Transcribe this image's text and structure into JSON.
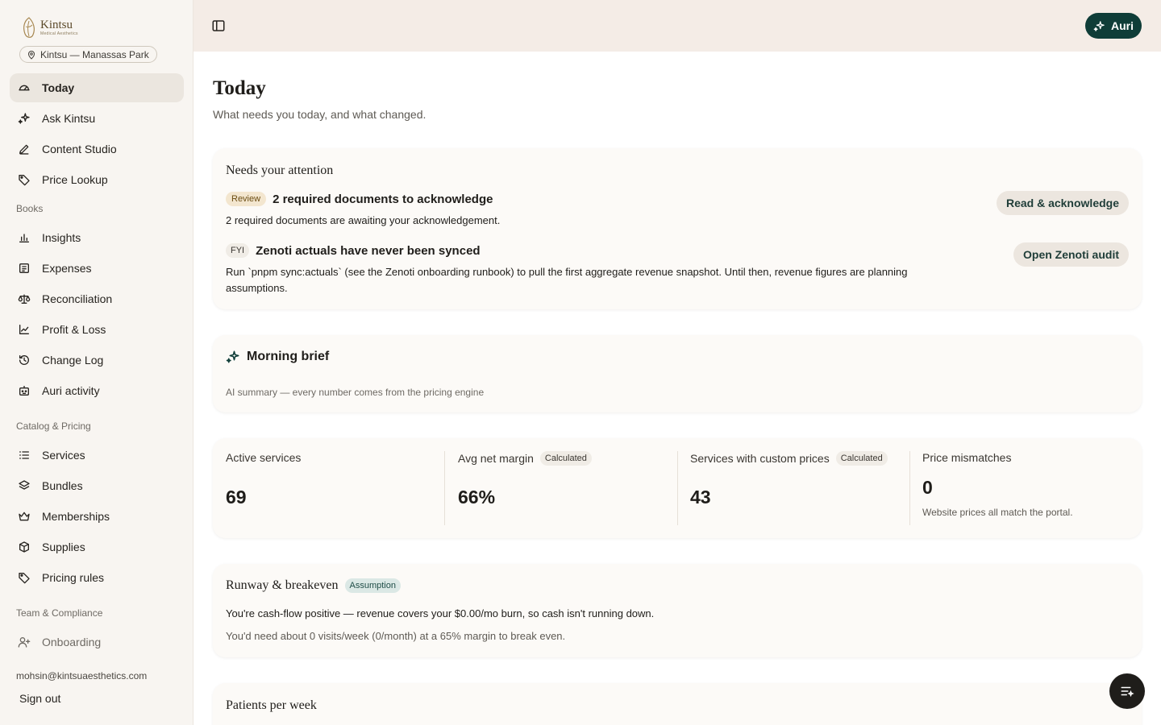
{
  "brand": {
    "name": "Kintsu",
    "subtitle": "Medical Aesthetics",
    "location": "Kintsu — Manassas Park"
  },
  "sidebar": {
    "primary": [
      {
        "label": "Today",
        "icon": "gauge-icon",
        "active": true
      },
      {
        "label": "Ask Kintsu",
        "icon": "sparkle-icon"
      },
      {
        "label": "Content Studio",
        "icon": "pen-icon"
      },
      {
        "label": "Price Lookup",
        "icon": "tag-icon"
      }
    ],
    "books_label": "Books",
    "books": [
      {
        "label": "Insights",
        "icon": "bar-chart-icon"
      },
      {
        "label": "Expenses",
        "icon": "receipt-icon"
      },
      {
        "label": "Reconciliation",
        "icon": "scale-icon"
      },
      {
        "label": "Profit & Loss",
        "icon": "line-chart-icon"
      },
      {
        "label": "Change Log",
        "icon": "history-icon"
      },
      {
        "label": "Auri activity",
        "icon": "bot-icon"
      }
    ],
    "catalog_label": "Catalog & Pricing",
    "catalog": [
      {
        "label": "Services",
        "icon": "list-icon"
      },
      {
        "label": "Bundles",
        "icon": "layers-icon"
      },
      {
        "label": "Memberships",
        "icon": "crown-icon"
      },
      {
        "label": "Supplies",
        "icon": "box-icon"
      },
      {
        "label": "Pricing rules",
        "icon": "tag-icon"
      }
    ],
    "team_label": "Team & Compliance",
    "team": [
      {
        "label": "Onboarding",
        "icon": "user-plus-icon"
      }
    ],
    "email": "mohsin@kintsuaesthetics.com",
    "signout": "Sign out"
  },
  "header": {
    "auri_label": "Auri"
  },
  "page": {
    "title": "Today",
    "subtitle": "What needs you today, and what changed."
  },
  "attention": {
    "title": "Needs your attention",
    "items": [
      {
        "tag": "Review",
        "title": "2 required documents to acknowledge",
        "desc": "2 required documents are awaiting your acknowledgement.",
        "action": "Read & acknowledge"
      },
      {
        "tag": "FYI",
        "title": "Zenoti actuals have never been synced",
        "desc": "Run `pnpm sync:actuals` (see the Zenoti onboarding runbook) to pull the first aggregate revenue snapshot. Until then, revenue figures are planning assumptions.",
        "action": "Open Zenoti audit"
      }
    ]
  },
  "brief": {
    "title": "Morning brief",
    "sub": "AI summary — every number comes from the pricing engine"
  },
  "stats": [
    {
      "label": "Active services",
      "tag": "",
      "value": "69",
      "note": ""
    },
    {
      "label": "Avg net margin",
      "tag": "Calculated",
      "value": "66%",
      "note": ""
    },
    {
      "label": "Services with custom prices",
      "tag": "Calculated",
      "value": "43",
      "note": ""
    },
    {
      "label": "Price mismatches",
      "tag": "",
      "value": "0",
      "note": "Website prices all match the portal."
    }
  ],
  "runway": {
    "title": "Runway & breakeven",
    "tag": "Assumption",
    "line1": "You're cash-flow positive — revenue covers your $0.00/mo burn, so cash isn't running down.",
    "line2": "You'd need about 0 visits/week (0/month) at a 65% margin to break even."
  },
  "patients": {
    "title": "Patients per week"
  },
  "colors": {
    "accent": "#0f3d38",
    "sidebar_bg": "#f8f5f1",
    "header_bg": "#f4ece6",
    "card_bg": "#fcfaf7"
  }
}
